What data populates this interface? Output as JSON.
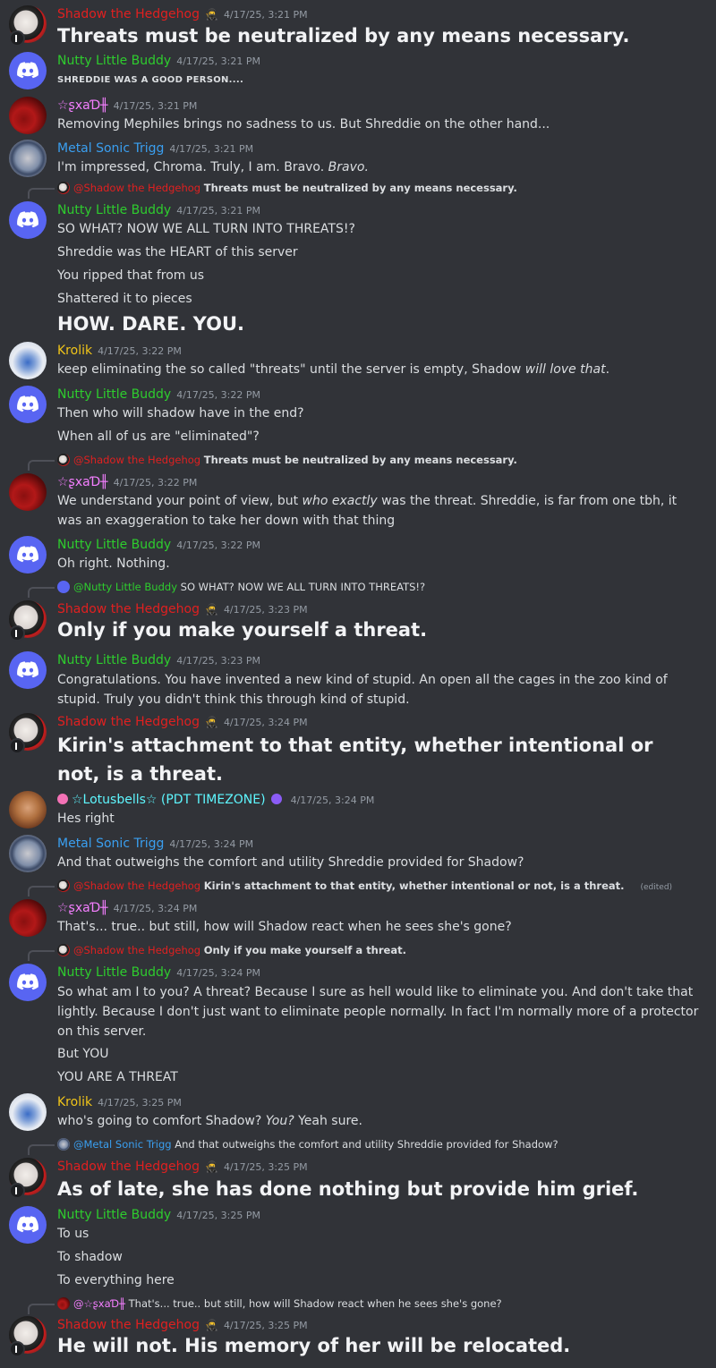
{
  "colors": {
    "background": "#313338",
    "shadow": "#e02020",
    "nutty": "#2ecc2e",
    "sxad": "#f47fff",
    "metal": "#3a9ff0",
    "krolik": "#f0c419",
    "lotus": "#5ef7ff",
    "timestamp": "#949ba4"
  },
  "messages": [
    {
      "author": "Shadow the Hedgehog",
      "time": "4/17/25, 3:21 PM",
      "lines": [
        "Threats must be neutralized by any means necessary."
      ]
    },
    {
      "author": "Nutty Little Buddy",
      "time": "4/17/25, 3:21 PM",
      "lines": [
        "SHREDDIE WAS A GOOD PERSON...."
      ]
    },
    {
      "author": "☆ʂxaƊ╫",
      "time": "4/17/25, 3:21 PM",
      "lines": [
        "Removing Mephiles brings no sadness to us. But Shreddie on the other hand..."
      ]
    },
    {
      "author": "Metal Sonic Trigg",
      "time": "4/17/25, 3:21 PM",
      "lines": [
        "I'm impressed, Chroma. Truly, I am. Bravo. ",
        "Bravo."
      ]
    },
    {
      "reply_to": "@Shadow the Hedgehog",
      "reply_text": "Threats must be neutralized by any means necessary.",
      "author": "Nutty Little Buddy",
      "time": "4/17/25, 3:21 PM",
      "lines": [
        "SO WHAT? NOW WE ALL TURN INTO THREATS!?",
        "Shreddie was the HEART of this server",
        "You ripped that from us",
        "Shattered it to pieces",
        "HOW. DARE. YOU."
      ]
    },
    {
      "author": "Krolik",
      "time": "4/17/25, 3:22 PM",
      "lines": [
        "keep eliminating the so called \"threats\" until the server is empty, Shadow ",
        "will love that",
        "."
      ]
    },
    {
      "author": "Nutty Little Buddy",
      "time": "4/17/25, 3:22 PM",
      "lines": [
        "Then who will shadow have in the end?",
        "When all of us are \"eliminated\"?"
      ]
    },
    {
      "reply_to": "@Shadow the Hedgehog",
      "reply_text": "Threats must be neutralized by any means necessary.",
      "author": "☆ʂxaƊ╫",
      "time": "4/17/25, 3:22 PM",
      "lines": [
        "We understand your point of view, but ",
        "who exactly",
        " was the threat. Shreddie, is far from one tbh, it was an exaggeration to take her down with that thing"
      ]
    },
    {
      "author": "Nutty Little Buddy",
      "time": "4/17/25, 3:22 PM",
      "lines": [
        "Oh right. Nothing."
      ]
    },
    {
      "reply_to": "@Nutty Little Buddy",
      "reply_text": "SO WHAT? NOW WE ALL TURN INTO THREATS!?",
      "author": "Shadow the Hedgehog",
      "time": "4/17/25, 3:23 PM",
      "lines": [
        "Only if you make yourself a threat."
      ]
    },
    {
      "author": "Nutty Little Buddy",
      "time": "4/17/25, 3:23 PM",
      "lines": [
        "Congratulations. You have invented a new kind of stupid. An open all the cages in the zoo kind of stupid. Truly you didn't think this through kind of stupid."
      ]
    },
    {
      "author": "Shadow the Hedgehog",
      "time": "4/17/25, 3:24 PM",
      "lines": [
        "Kirin's attachment to that entity, whether intentional or not, is a threat."
      ]
    },
    {
      "author": "☆Lotusbells☆ (PDT TIMEZONE)",
      "time": "4/17/25, 3:24 PM",
      "lines": [
        "Hes right"
      ]
    },
    {
      "author": "Metal Sonic Trigg",
      "time": "4/17/25, 3:24 PM",
      "lines": [
        "And that outweighs the comfort and utility Shreddie provided for Shadow?"
      ]
    },
    {
      "reply_to": "@Shadow the Hedgehog",
      "reply_text": "Kirin's attachment to that entity, whether intentional or not, is a threat.",
      "reply_edited": "(edited)",
      "author": "☆ʂxaƊ╫",
      "time": "4/17/25, 3:24 PM",
      "lines": [
        "That's... true.. but still, how will Shadow react when he sees she's gone?"
      ]
    },
    {
      "reply_to": "@Shadow the Hedgehog",
      "reply_text": "Only if you make yourself a threat.",
      "author": "Nutty Little Buddy",
      "time": "4/17/25, 3:24 PM",
      "lines": [
        "So what am I to you? A threat? Because I sure as hell would like to eliminate you. And don't take that lightly. Because I don't just want to eliminate people normally. In fact I'm normally more of a protector on this server.",
        "But YOU",
        "YOU ARE A THREAT"
      ]
    },
    {
      "author": "Krolik",
      "time": "4/17/25, 3:25 PM",
      "lines": [
        "who's going to comfort Shadow? ",
        "You?",
        " Yeah sure."
      ]
    },
    {
      "reply_to": "@Metal Sonic Trigg",
      "reply_text": "And that outweighs the comfort and utility Shreddie provided for Shadow?",
      "author": "Shadow the Hedgehog",
      "time": "4/17/25, 3:25 PM",
      "lines": [
        "As of late, she has done nothing but provide him grief."
      ]
    },
    {
      "author": "Nutty Little Buddy",
      "time": "4/17/25, 3:25 PM",
      "lines": [
        "To us",
        "To shadow",
        "To everything here"
      ]
    },
    {
      "reply_to": "@☆ʂxaƊ╫",
      "reply_text": "That's... true.. but still, how will Shadow react when he sees she's gone?",
      "author": "Shadow the Hedgehog",
      "time": "4/17/25, 3:25 PM",
      "lines": [
        "He will not. His memory of her will be relocated."
      ]
    }
  ]
}
